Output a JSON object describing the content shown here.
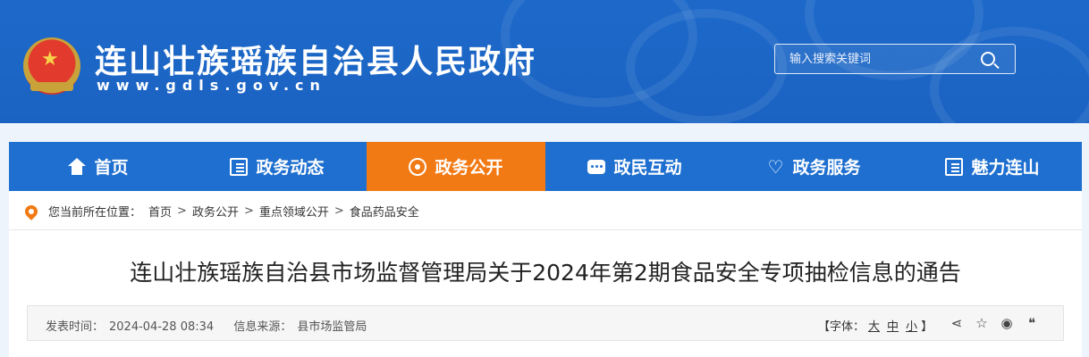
{
  "header": {
    "site_title": "连山壮族瑶族自治县人民政府",
    "site_url": "www.gdls.gov.cn",
    "search_placeholder": "输入搜索关键词"
  },
  "nav": [
    {
      "label": "首页",
      "icon": "home-icon"
    },
    {
      "label": "政务动态",
      "icon": "list-icon"
    },
    {
      "label": "政务公开",
      "icon": "eye-icon",
      "active": true
    },
    {
      "label": "政民互动",
      "icon": "chat-icon"
    },
    {
      "label": "政务服务",
      "icon": "heart-hand-icon"
    },
    {
      "label": "魅力连山",
      "icon": "book-icon"
    }
  ],
  "breadcrumb": {
    "prefix": "您当前所在位置：",
    "items": [
      "首页",
      "政务公开",
      "重点领域公开",
      "食品药品安全"
    ],
    "separator": ">"
  },
  "article": {
    "title": "连山壮族瑶族自治县市场监督管理局关于2024年第2期食品安全专项抽检信息的通告",
    "publish_label": "发表时间：",
    "publish_time": "2024-04-28 08:34",
    "source_label": "信息来源：",
    "source": "县市场监管局",
    "font_label": "【字体：",
    "font_large": "大",
    "font_medium": "中",
    "font_small": "小",
    "font_close": "】"
  },
  "colors": {
    "header_blue": "#1b63c3",
    "nav_blue": "#1e6fd0",
    "active_orange": "#f27a15"
  }
}
